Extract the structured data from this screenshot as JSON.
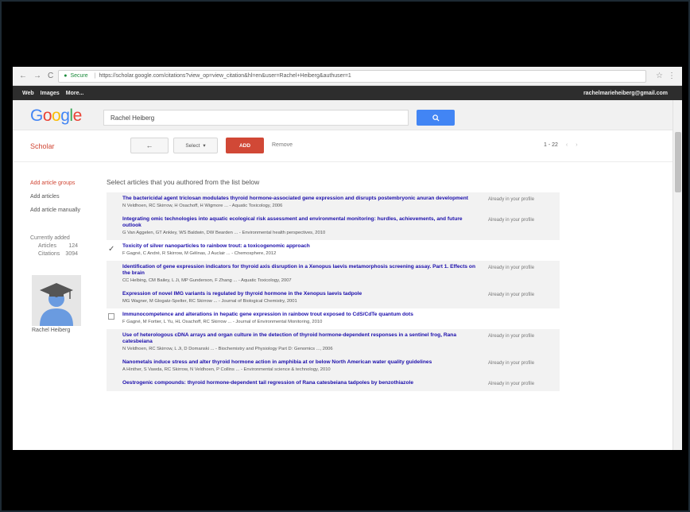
{
  "browser": {
    "secure_label": "Secure",
    "url": "https://scholar.google.com/citations?view_op=view_citation&hl=en&user=Rachel+Heiberg&authuser=1",
    "nav_back": "←",
    "nav_forward": "→",
    "nav_reload": "C"
  },
  "gbar": {
    "links": [
      "Web",
      "Images",
      "More..."
    ],
    "email": "rachelmarieheiberg@gmail.com"
  },
  "search": {
    "value": "Rachel Heiberg"
  },
  "toolbar": {
    "scholar_label": "Scholar",
    "back_label": "←",
    "select_label": "Select",
    "add_label": "ADD",
    "remove_label": "Remove",
    "pager": "1 - 22"
  },
  "sidebar": {
    "items": [
      "Add article groups",
      "Add articles",
      "Add article manually"
    ],
    "counts_label": "Currently added",
    "articles_label": "Articles",
    "articles_value": "124",
    "citations_label": "Citations",
    "citations_value": "3094",
    "profile_name": "Rachel Heiberg"
  },
  "main": {
    "title": "Select articles that you authored from the list below",
    "articles": [
      {
        "title": "The bactericidal agent triclosan modulates thyroid hormone-associated gene expression and disrupts postembryonic anuran development",
        "meta": "N Veldhoen, RC Skirrow, H Osachoff, H Wigmore ... - Aquatic Toxicology, 2006",
        "status": "Already in your profile",
        "checked": false
      },
      {
        "title": "Integrating omic technologies into aquatic ecological risk assessment and environmental monitoring: hurdles, achievements, and future outlook",
        "meta": "G Van Aggelen, GT Ankley, WS Baldwin, DW Bearden ... - Environmental health perspectives, 2010",
        "status": "Already in your profile",
        "checked": false
      },
      {
        "title": "Toxicity of silver nanoparticles to rainbow trout: a toxicogenomic approach",
        "meta": "F Gagné, C André, R Skirrow, M Gélinas, J Auclair ... - Chemosphere, 2012",
        "status": "",
        "checked": true
      },
      {
        "title": "Identification of gene expression indicators for thyroid axis disruption in a Xenopus laevis metamorphosis screening assay. Part 1. Effects on the brain",
        "meta": "CC Helbing, CM Bailey, L Ji, MP Gunderson, F Zhang ... - Aquatic Toxicology, 2007",
        "status": "Already in your profile",
        "checked": false
      },
      {
        "title": "Expression of novel IMG variants is regulated by thyroid hormone in the Xenopus laevis tadpole",
        "meta": "MG Wagner, M Glogatz-Spelter, RC Skirrow ... - Journal of Biological Chemistry, 2001",
        "status": "Already in your profile",
        "checked": false
      },
      {
        "title": "Immunocompetence and alterations in hepatic gene expression in rainbow trout exposed to CdS/CdTe quantum dots",
        "meta": "F Gagné, M Fortier, L Yu, HL Osachoff, RC Skirrow ... - Journal of Environmental Monitoring, 2010",
        "status": "",
        "checked": false
      },
      {
        "title": "Use of heterologous cDNA arrays and organ culture in the detection of thyroid hormone-dependent responses in a sentinel frog, Rana catesbeiana",
        "meta": "N Veldhoen, RC Skirrow, L Ji, D Domanski ... - Biochemistry and Physiology Part D: Genomics ..., 2006",
        "status": "Already in your profile",
        "checked": false
      },
      {
        "title": "Nanometals induce stress and alter thyroid hormone action in amphibia at or below North American water quality guidelines",
        "meta": "A Hinther, S Vawda, RC Skirrow, N Veldhoen, P Collins ... - Environmental science & technology, 2010",
        "status": "Already in your profile",
        "checked": false
      },
      {
        "title": "Oestrogenic compounds: thyroid hormone-dependent tail regression of Rana catesbeiana tadpoles by benzothiazole",
        "meta": "",
        "status": "Already in your profile",
        "checked": false
      }
    ]
  }
}
